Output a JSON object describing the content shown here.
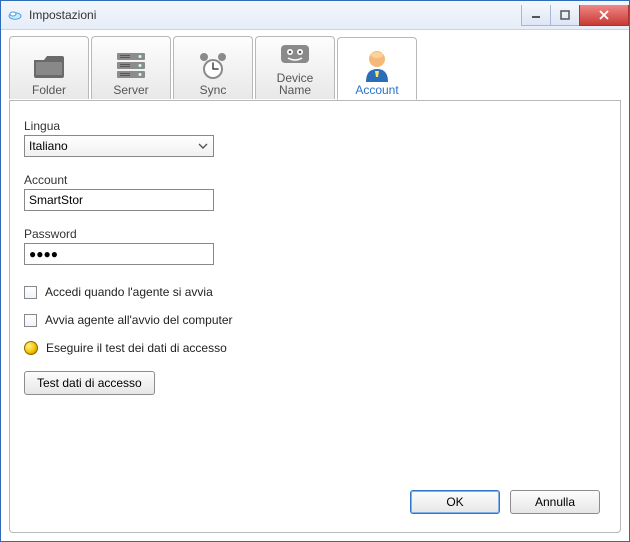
{
  "window": {
    "title": "Impostazioni"
  },
  "tabs": {
    "folder": "Folder",
    "server": "Server",
    "sync": "Sync",
    "device": "Device\nName",
    "account": "Account"
  },
  "form": {
    "lingua_label": "Lingua",
    "lingua_value": "Italiano",
    "account_label": "Account",
    "account_value": "SmartStor",
    "password_label": "Password",
    "password_value": "●●●●",
    "chk_login_on_start": "Accedi quando l'agente si avvia",
    "chk_start_with_os": "Avvia agente all'avvio del computer",
    "led_test_label": "Eseguire il test dei dati di accesso",
    "test_button": "Test dati di accesso"
  },
  "buttons": {
    "ok": "OK",
    "cancel": "Annulla"
  }
}
